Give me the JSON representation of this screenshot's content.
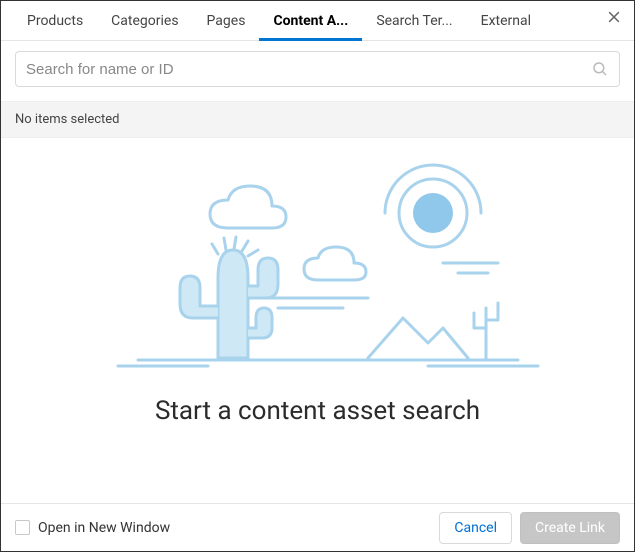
{
  "tabs": [
    "Products",
    "Categories",
    "Pages",
    "Content A...",
    "Search Ter...",
    "External"
  ],
  "active_tab_index": 3,
  "search": {
    "placeholder": "Search for name or ID"
  },
  "status": {
    "selection_text": "No items selected"
  },
  "empty_state": {
    "prompt": "Start a content asset search"
  },
  "footer": {
    "open_new_window_label": "Open in New Window",
    "cancel_label": "Cancel",
    "create_label": "Create Link"
  }
}
